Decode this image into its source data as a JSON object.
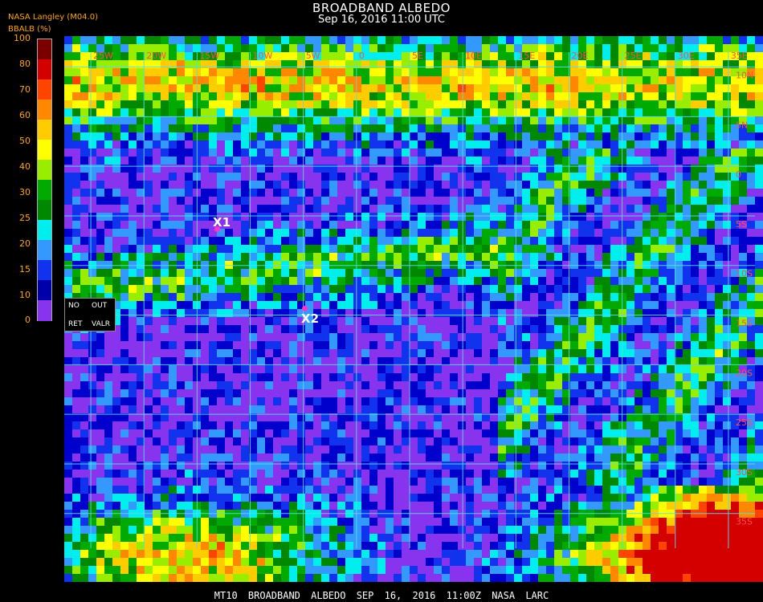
{
  "header": {
    "title": "BROADBAND ALBEDO",
    "subtitle": "Sep 16, 2016 11:00 UTC",
    "source": "NASA Langley (M04.0)",
    "colorbar_label": "BBALB (%)"
  },
  "colorbar": {
    "ticks": [
      "100",
      "80",
      "70",
      "60",
      "50",
      "40",
      "30",
      "25",
      "20",
      "15",
      "10",
      "5",
      "0"
    ],
    "colors": [
      "#7a0000",
      "#d40000",
      "#ff4400",
      "#ff8800",
      "#ffcc00",
      "#ffff00",
      "#99ee00",
      "#00aa00",
      "#008800",
      "#00eeee",
      "#3399ff",
      "#1133ee",
      "#0000aa",
      "#8833ee"
    ]
  },
  "controls": {
    "no": "NO",
    "out": "OUT",
    "ret": "RET",
    "valr": "VALR"
  },
  "markers": {
    "x1": "X1",
    "x2": "X2"
  },
  "grid": {
    "top_labels": [
      "25W",
      "20W",
      "15W",
      "10W",
      "5W",
      "0",
      "5E",
      "10E",
      "15E",
      "20E",
      "25E",
      "30E",
      "35E"
    ],
    "right_labels": [
      "10N",
      "5N",
      "0",
      "5S",
      "10S",
      "15S",
      "20S",
      "25S",
      "30S",
      "35S"
    ]
  },
  "footer": {
    "text": "MT10  BROADBAND ALBEDO  SEP 16, 2016 11:00Z  NASA LARC"
  }
}
